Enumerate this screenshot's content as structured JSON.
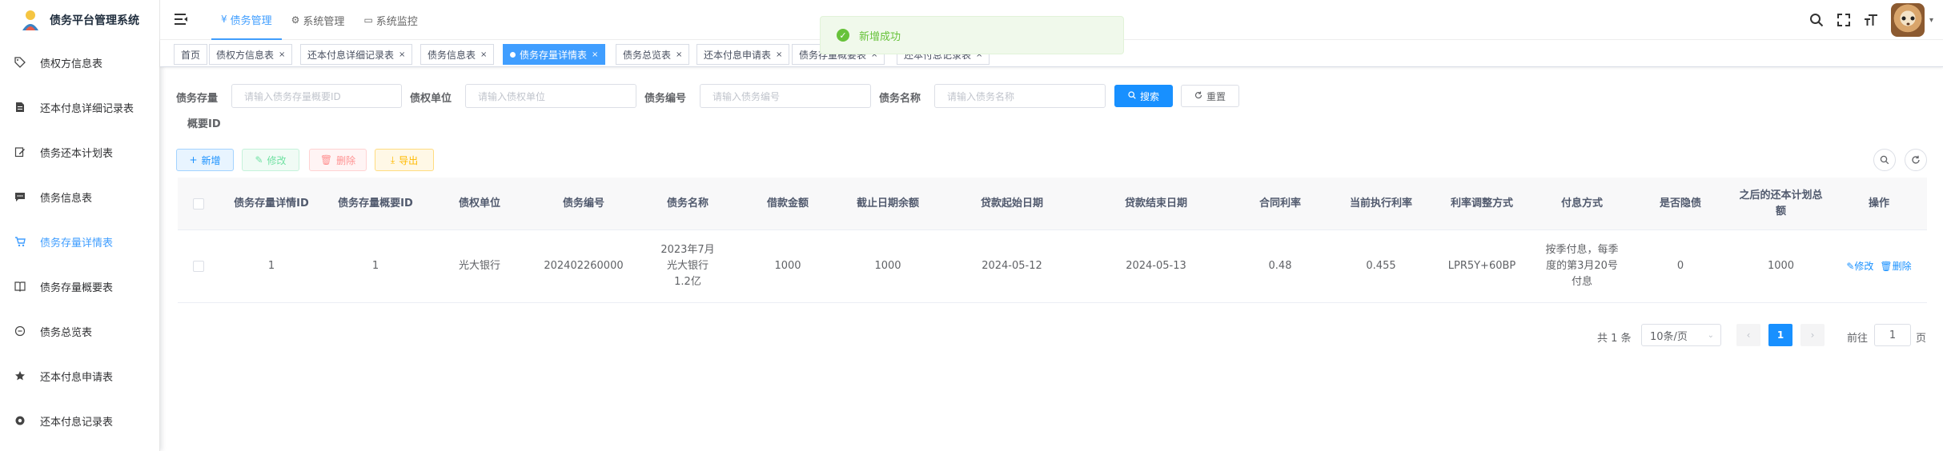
{
  "app": {
    "title": "债务平台管理系统"
  },
  "sidebar": {
    "items": [
      {
        "label": "债权方信息表",
        "icon": "tag-icon"
      },
      {
        "label": "还本付息详细记录表",
        "icon": "document-icon"
      },
      {
        "label": "债务还本计划表",
        "icon": "edit-icon"
      },
      {
        "label": "债务信息表",
        "icon": "message-icon"
      },
      {
        "label": "债务存量详情表",
        "icon": "cart-icon"
      },
      {
        "label": "债务存量概要表",
        "icon": "book-icon"
      },
      {
        "label": "债务总览表",
        "icon": "circle-dash-icon"
      },
      {
        "label": "还本付息申请表",
        "icon": "star-icon"
      },
      {
        "label": "还本付息记录表",
        "icon": "gear-icon"
      }
    ]
  },
  "topnav": {
    "items": [
      {
        "label": "债务管理",
        "glyph": "¥"
      },
      {
        "label": "系统管理",
        "glyph": "⚙"
      },
      {
        "label": "系统监控",
        "glyph": "▭"
      }
    ]
  },
  "tags": [
    {
      "label": "首页"
    },
    {
      "label": "债权方信息表",
      "x": "×"
    },
    {
      "label": "还本付息详细记录表",
      "x": "×"
    },
    {
      "label": "债务信息表",
      "x": "×"
    },
    {
      "label": "债务存量详情表",
      "x": "×"
    },
    {
      "label": "债务总览表",
      "x": "×"
    },
    {
      "label": "还本付息申请表",
      "x": "×"
    },
    {
      "label": "债务存量概要表",
      "x": "×"
    },
    {
      "label": "还本付息记录表",
      "x": "×"
    }
  ],
  "toast": {
    "message": "新增成功",
    "check": "✓"
  },
  "search": {
    "label_summary_a": "债务存量",
    "label_summary_b": "概要ID",
    "placeholder_summary": "请输入债务存量概要ID",
    "label_creditor": "债权单位",
    "placeholder_creditor": "请输入债权单位",
    "label_debt_no": "债务编号",
    "placeholder_debt_no": "请输入债务编号",
    "label_debt_name": "债务名称",
    "placeholder_debt_name": "请输入债务名称",
    "search_btn": "搜索",
    "reset_btn": "重置"
  },
  "toolbar": {
    "add": "新增",
    "edit": "修改",
    "delete": "删除",
    "export": "导出"
  },
  "table": {
    "headers": [
      "债务存量详情ID",
      "债务存量概要ID",
      "债权单位",
      "债务编号",
      "债务名称",
      "借款金额",
      "截止日期余额",
      "贷款起始日期",
      "贷款结束日期",
      "合同利率",
      "当前执行利率",
      "利率调整方式",
      "付息方式",
      "是否隐债",
      "之后的还本计划总额",
      "操作"
    ],
    "rows": [
      {
        "cells": [
          "1",
          "1",
          "光大银行",
          "202402260000",
          "2023年7月光大银行1.2亿",
          "1000",
          "1000",
          "2024-05-12",
          "2024-05-13",
          "0.48",
          "0.455",
          "LPR5Y+60BP",
          "按季付息，每季度的第3月20号付息",
          "0",
          "1000"
        ],
        "edit": "修改",
        "delete": "删除"
      }
    ]
  },
  "pagination": {
    "total": "共 1 条",
    "page_size": "10条/页",
    "current": "1",
    "goto_label": "前往",
    "goto_value": "1",
    "page_suffix": "页"
  }
}
